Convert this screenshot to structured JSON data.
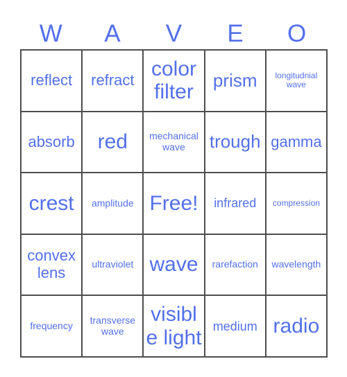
{
  "card": {
    "title_letters": [
      "W",
      "A",
      "V",
      "E",
      "O"
    ],
    "accent_color": "#5370ea",
    "grid_line_color": "#4d4d4d",
    "background_color": "#ffffff",
    "columns": 5,
    "rows": 5,
    "free_space": {
      "row": 3,
      "column": 3,
      "label": "Free!"
    },
    "cells": [
      [
        {
          "label": "reflect",
          "size": "l"
        },
        {
          "label": "refract",
          "size": "l"
        },
        {
          "label": "color filter",
          "size": "xxl"
        },
        {
          "label": "prism",
          "size": "xl"
        },
        {
          "label": "longitudnial wave",
          "size": "xs"
        }
      ],
      [
        {
          "label": "absorb",
          "size": "l"
        },
        {
          "label": "red",
          "size": "xxl"
        },
        {
          "label": "mechanical wave",
          "size": "s"
        },
        {
          "label": "trough",
          "size": "xl"
        },
        {
          "label": "gamma",
          "size": "l"
        }
      ],
      [
        {
          "label": "crest",
          "size": "xxl"
        },
        {
          "label": "amplitude",
          "size": "s"
        },
        {
          "label": "Free!",
          "size": "xxl"
        },
        {
          "label": "infrared",
          "size": "m"
        },
        {
          "label": "compression",
          "size": "xs"
        }
      ],
      [
        {
          "label": "convex lens",
          "size": "l"
        },
        {
          "label": "ultraviolet",
          "size": "s"
        },
        {
          "label": "wave",
          "size": "xxl"
        },
        {
          "label": "rarefaction",
          "size": "s"
        },
        {
          "label": "wavelength",
          "size": "s"
        }
      ],
      [
        {
          "label": "frequency",
          "size": "s"
        },
        {
          "label": "transverse wave",
          "size": "s"
        },
        {
          "label": "visible light",
          "size": "xxl"
        },
        {
          "label": "medium",
          "size": "m"
        },
        {
          "label": "radio",
          "size": "xxl"
        }
      ]
    ]
  }
}
